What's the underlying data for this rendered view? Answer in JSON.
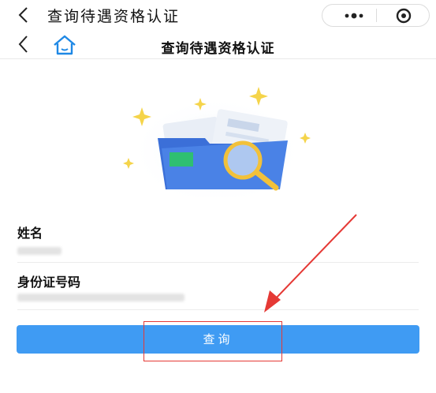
{
  "topbar": {
    "title": "查询待遇资格认证",
    "back_icon": "chevron-left-icon",
    "more_icon": "more-dots-icon",
    "target_icon": "target-icon"
  },
  "navbar": {
    "title": "查询待遇资格认证",
    "back_icon": "chevron-left-icon",
    "home_icon": "home-icon"
  },
  "form": {
    "name_label": "姓名",
    "id_label": "身份证号码"
  },
  "button": {
    "label": "查询"
  },
  "colors": {
    "primary": "#3f9bf3",
    "annotation": "#e53935",
    "home_icon": "#1e88e5"
  }
}
